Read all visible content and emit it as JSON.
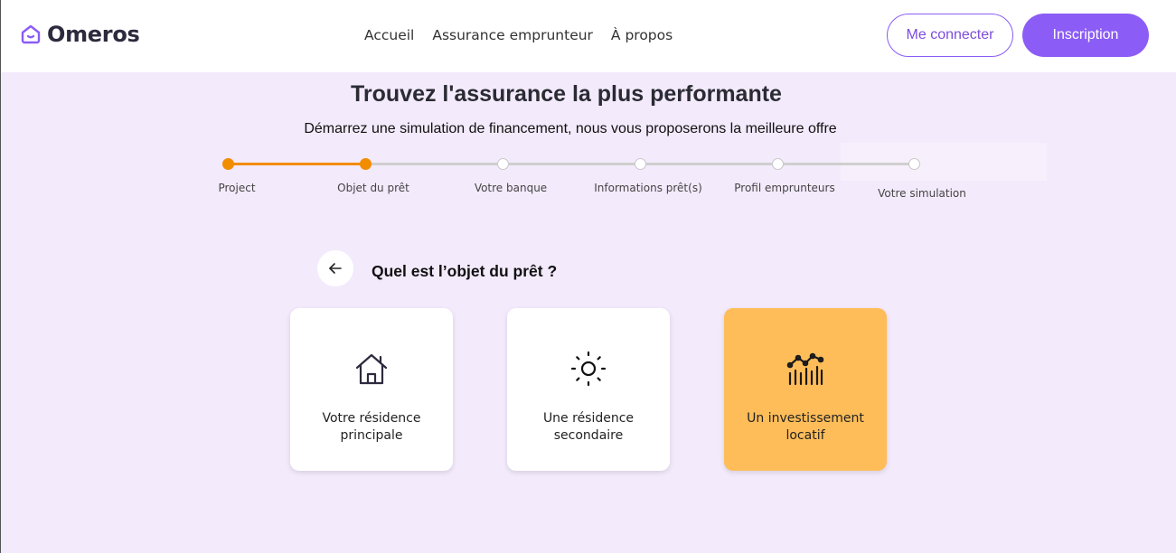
{
  "brand": {
    "name": "Omeros",
    "accent": "#8b5cf6",
    "progress_color": "#f28c00",
    "selected_card_color": "#ffbd59"
  },
  "nav": [
    {
      "label": "Accueil"
    },
    {
      "label": "Assurance emprunteur"
    },
    {
      "label": "À propos"
    }
  ],
  "auth": {
    "login_label": "Me connecter",
    "signup_label": "Inscription"
  },
  "hero": {
    "title": "Trouvez l'assurance la plus performante",
    "subtitle": "Démarrez une simulation de financement, nous vous proposerons la meilleure offre"
  },
  "stepper": {
    "current_step": 2,
    "steps": [
      {
        "label": "Project",
        "done": true
      },
      {
        "label": "Objet du prêt",
        "done": true
      },
      {
        "label": "Votre banque",
        "done": false
      },
      {
        "label": "Informations prêt(s)",
        "done": false
      },
      {
        "label": "Profil emprunteurs",
        "done": false
      },
      {
        "label": "Votre simulation",
        "done": false
      }
    ]
  },
  "question": {
    "text": "Quel est l’objet du prêt ?",
    "back_icon": "arrow-left-icon"
  },
  "options": [
    {
      "line1": "Votre résidence",
      "line2": "principale",
      "icon": "house-icon",
      "selected": false
    },
    {
      "line1": "Une résidence",
      "line2": "secondaire",
      "icon": "sun-icon",
      "selected": false
    },
    {
      "line1": "Un investissement",
      "line2": "locatif",
      "icon": "chart-icon",
      "selected": true
    }
  ]
}
